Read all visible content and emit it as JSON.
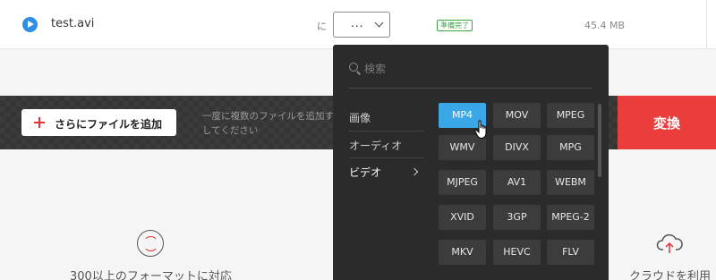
{
  "file": {
    "name": "test.avi",
    "to_label": "に",
    "selected_format": "...",
    "status": "準備完了",
    "size": "45.4 MB"
  },
  "toolbar": {
    "add_file_label": "さらにファイルを追加",
    "hint": "一度に複数のファイルを追加す\nしてください",
    "convert_label": "変換"
  },
  "features": {
    "formats_text": "300以上のフォーマットに対応",
    "cloud_text": "クラウドを利用"
  },
  "dropdown": {
    "search_placeholder": "検索",
    "categories": [
      {
        "label": "画像"
      },
      {
        "label": "オーディオ"
      },
      {
        "label": "ビデオ"
      }
    ],
    "selected_category": "ビデオ",
    "formats": [
      "MP4",
      "MOV",
      "MPEG",
      "WMV",
      "DIVX",
      "MPG",
      "MJPEG",
      "AV1",
      "WEBM",
      "XVID",
      "3GP",
      "MPEG-2",
      "MKV",
      "HEVC",
      "FLV"
    ],
    "selected_format": "MP4"
  },
  "colors": {
    "accent_red": "#ec3d3d",
    "selected_blue": "#3aa7e8",
    "status_green": "#3aa64a"
  },
  "icons": {
    "file": "play-circle-icon",
    "add": "plus-icon",
    "search": "search-icon",
    "formats": "sync-icon",
    "cloud": "cloud-upload-icon"
  }
}
